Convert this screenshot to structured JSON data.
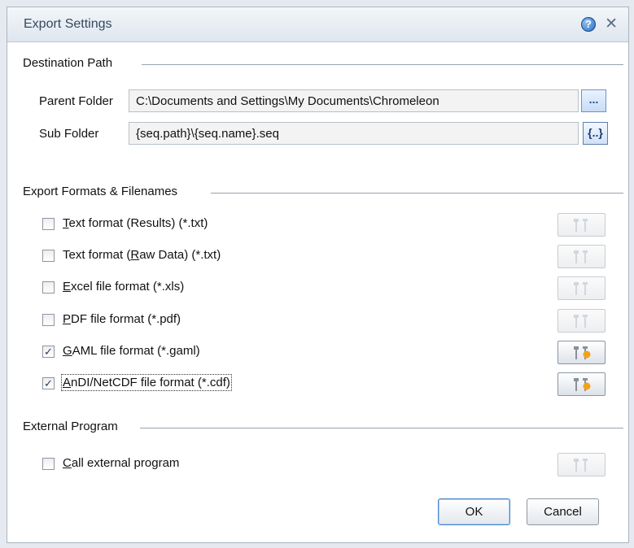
{
  "dialog": {
    "title": "Export Settings"
  },
  "destination": {
    "header": "Destination Path",
    "parent_label": "Parent Folder",
    "parent_value": "C:\\Documents and Settings\\My Documents\\Chromeleon",
    "parent_button": "...",
    "sub_label": "Sub Folder",
    "sub_value": "{seq.path}\\{seq.name}.seq",
    "sub_button": "{..}"
  },
  "formats": {
    "header": "Export Formats & Filenames",
    "items": [
      {
        "pre": "",
        "key": "T",
        "post": "ext format (Results) (*.txt)",
        "checked": false,
        "enabled": false
      },
      {
        "pre": "Text format (",
        "key": "R",
        "post": "aw Data) (*.txt)",
        "checked": false,
        "enabled": false
      },
      {
        "pre": "",
        "key": "E",
        "post": "xcel file format (*.xls)",
        "checked": false,
        "enabled": false
      },
      {
        "pre": "",
        "key": "P",
        "post": "DF file format (*.pdf)",
        "checked": false,
        "enabled": false
      },
      {
        "pre": "",
        "key": "G",
        "post": "AML file format (*.gaml)",
        "checked": true,
        "enabled": true
      },
      {
        "pre": "",
        "key": "A",
        "post": "nDI/NetCDF file format (*.cdf)",
        "checked": true,
        "enabled": true
      }
    ]
  },
  "external": {
    "header": "External Program",
    "item": {
      "pre": "",
      "key": "C",
      "post": "all external program",
      "checked": false,
      "enabled": false
    }
  },
  "buttons": {
    "ok": "OK",
    "cancel": "Cancel"
  },
  "icons": {
    "help": "help-icon",
    "close": "close-icon",
    "settings": "tools-settings-icon"
  }
}
